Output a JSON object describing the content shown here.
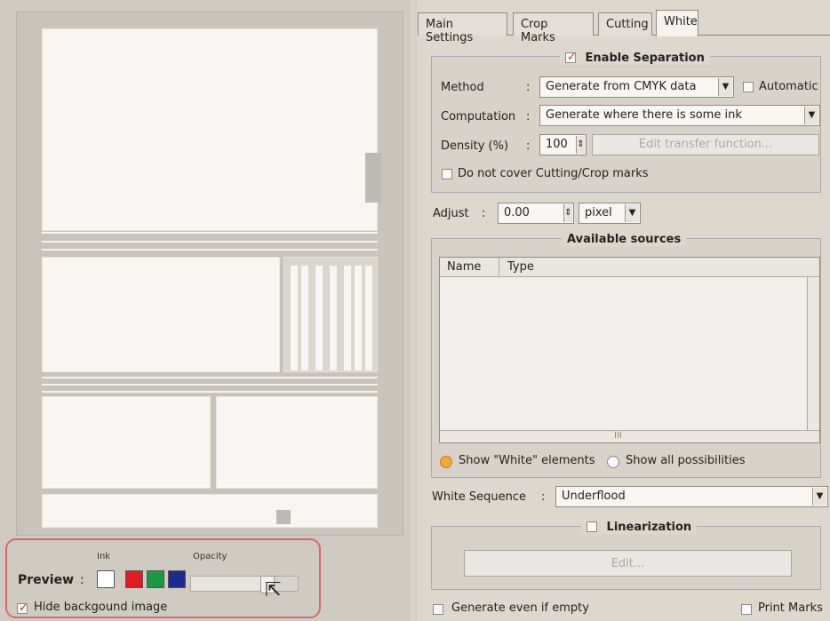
{
  "tabs": [
    "Main Settings",
    "Crop Marks",
    "Cutting",
    "White"
  ],
  "preview": {
    "ink_label": "Ink",
    "opacity_label": "Opacity",
    "preview_label": "Preview",
    "colon": ":",
    "hide_background": "Hide backgound image",
    "opacity_value": 0.72,
    "swatches": [
      "#ffffff",
      "#e11b22",
      "#1c9a43",
      "#1d2b8f"
    ]
  },
  "separation": {
    "enable_label": "Enable Separation",
    "method_label": "Method",
    "method_colon": ":",
    "method_value": "Generate from CMYK data",
    "automatic_label": "Automatic",
    "computation_label": "Computation",
    "computation_colon": ":",
    "computation_value": "Generate where there is some ink",
    "density_label": "Density (%)",
    "density_colon": ":",
    "density_value": "100",
    "edit_transfer": "Edit transfer function...",
    "do_not_cover": "Do not cover Cutting/Crop marks"
  },
  "adjust": {
    "label": "Adjust",
    "colon": ":",
    "value": "0.00",
    "unit": "pixel"
  },
  "available_sources": {
    "title": "Available sources",
    "columns": [
      "Name",
      "Type"
    ],
    "scroll_mark": "III"
  },
  "show_white": "Show \"White\" elements",
  "show_all": "Show all possibilities",
  "white_sequence": {
    "label": "White Sequence",
    "colon": ":",
    "value": "Underflood"
  },
  "linearization": {
    "title": "Linearization",
    "edit_button": "Edit..."
  },
  "footer": {
    "generate_even_if_empty": "Generate even if empty",
    "print_marks": "Print Marks"
  }
}
